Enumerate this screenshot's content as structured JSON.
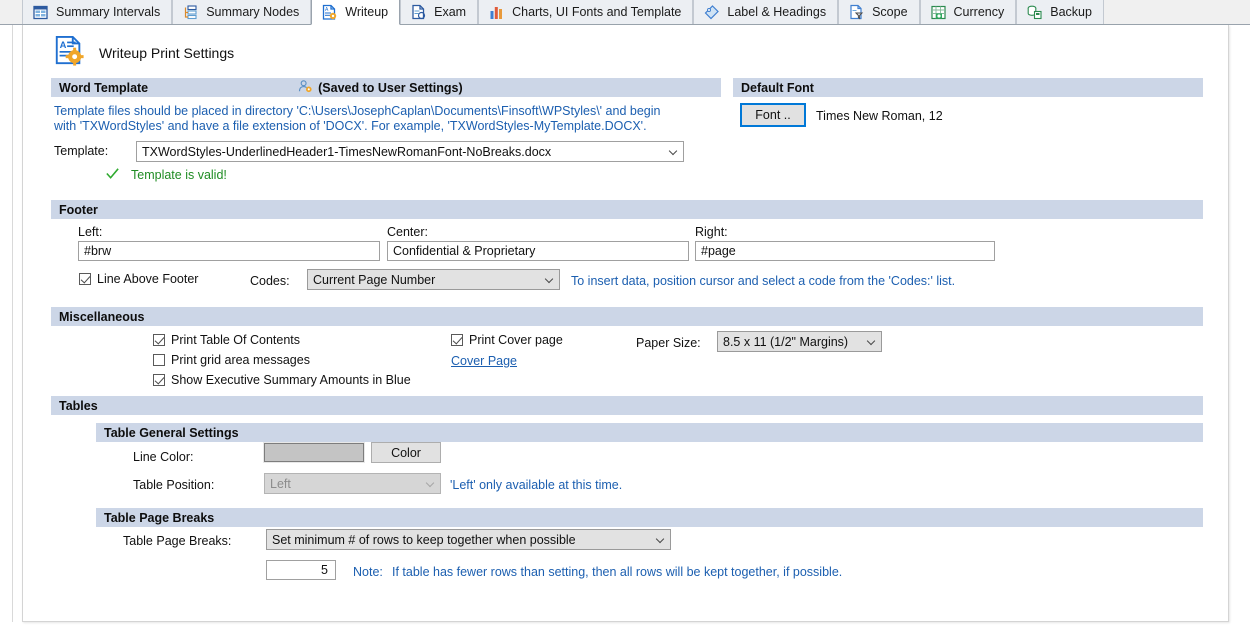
{
  "tabs": [
    {
      "label": "Summary Intervals",
      "icon": "calendar-grid-icon",
      "active": false
    },
    {
      "label": "Summary Nodes",
      "icon": "tree-nodes-icon",
      "active": false
    },
    {
      "label": "Writeup",
      "icon": "document-gear-icon",
      "active": true
    },
    {
      "label": "Exam",
      "icon": "document-exam-icon",
      "active": false
    },
    {
      "label": "Charts, UI Fonts and Template",
      "icon": "bar-chart-icon",
      "active": false
    },
    {
      "label": "Label & Headings",
      "icon": "tag-icon",
      "active": false
    },
    {
      "label": "Scope",
      "icon": "document-funnel-icon",
      "active": false
    },
    {
      "label": "Currency",
      "icon": "currency-grid-icon",
      "active": false
    },
    {
      "label": "Backup",
      "icon": "backup-stack-icon",
      "active": false
    }
  ],
  "page": {
    "title": "Writeup Print Settings",
    "icon": "document-gear-icon"
  },
  "word_template": {
    "section_title": "Word Template",
    "saved_note": "(Saved to User Settings)",
    "saved_note_icon": "user-gear-icon",
    "help_line1": "Template files should be placed in directory 'C:\\Users\\JosephCaplan\\Documents\\Finsoft\\WPStyles\\' and begin",
    "help_line2": "with 'TXWordStyles' and have a file extension of 'DOCX'.  For example, 'TXWordStyles-MyTemplate.DOCX'.",
    "template_label": "Template:",
    "template_value": "TXWordStyles-UnderlinedHeader1-TimesNewRomanFont-NoBreaks.docx",
    "valid_text": "Template is valid!",
    "valid_icon": "checkmark-icon"
  },
  "default_font": {
    "section_title": "Default Font",
    "button_label": "Font ..",
    "value": "Times New Roman, 12"
  },
  "footer": {
    "section_title": "Footer",
    "left_label": "Left:",
    "left_value": "#brw",
    "center_label": "Center:",
    "center_value": "Confidential & Proprietary",
    "right_label": "Right:",
    "right_value": "#page",
    "line_above_label": "Line Above Footer",
    "line_above_checked": true,
    "codes_label": "Codes:",
    "codes_value": "Current Page Number",
    "codes_hint": "To insert data, position cursor and select a code from the 'Codes:' list."
  },
  "miscellaneous": {
    "section_title": "Miscellaneous",
    "print_toc_label": "Print Table Of Contents",
    "print_toc_checked": true,
    "print_grid_label": "Print grid area messages",
    "print_grid_checked": false,
    "exec_summary_label": "Show Executive Summary Amounts in Blue",
    "exec_summary_checked": true,
    "print_cover_label": "Print Cover page",
    "print_cover_checked": true,
    "cover_page_link": "Cover Page",
    "paper_size_label": "Paper Size:",
    "paper_size_value": "8.5 x 11 (1/2\" Margins)"
  },
  "tables": {
    "section_title": "Tables",
    "general": {
      "section_title": "Table General Settings",
      "line_color_label": "Line Color:",
      "line_color_swatch": "#c4c4c4",
      "color_button_label": "Color",
      "table_position_label": "Table Position:",
      "table_position_value": "Left",
      "table_position_note": "'Left' only available at this time."
    },
    "page_breaks": {
      "section_title": "Table Page Breaks",
      "label": "Table Page Breaks:",
      "value": "Set minimum # of rows to keep together when possible",
      "rows_value": "5",
      "note_prefix": "Note:",
      "note_text": "If table has fewer rows than setting, then all rows will be kept together, if possible."
    }
  }
}
